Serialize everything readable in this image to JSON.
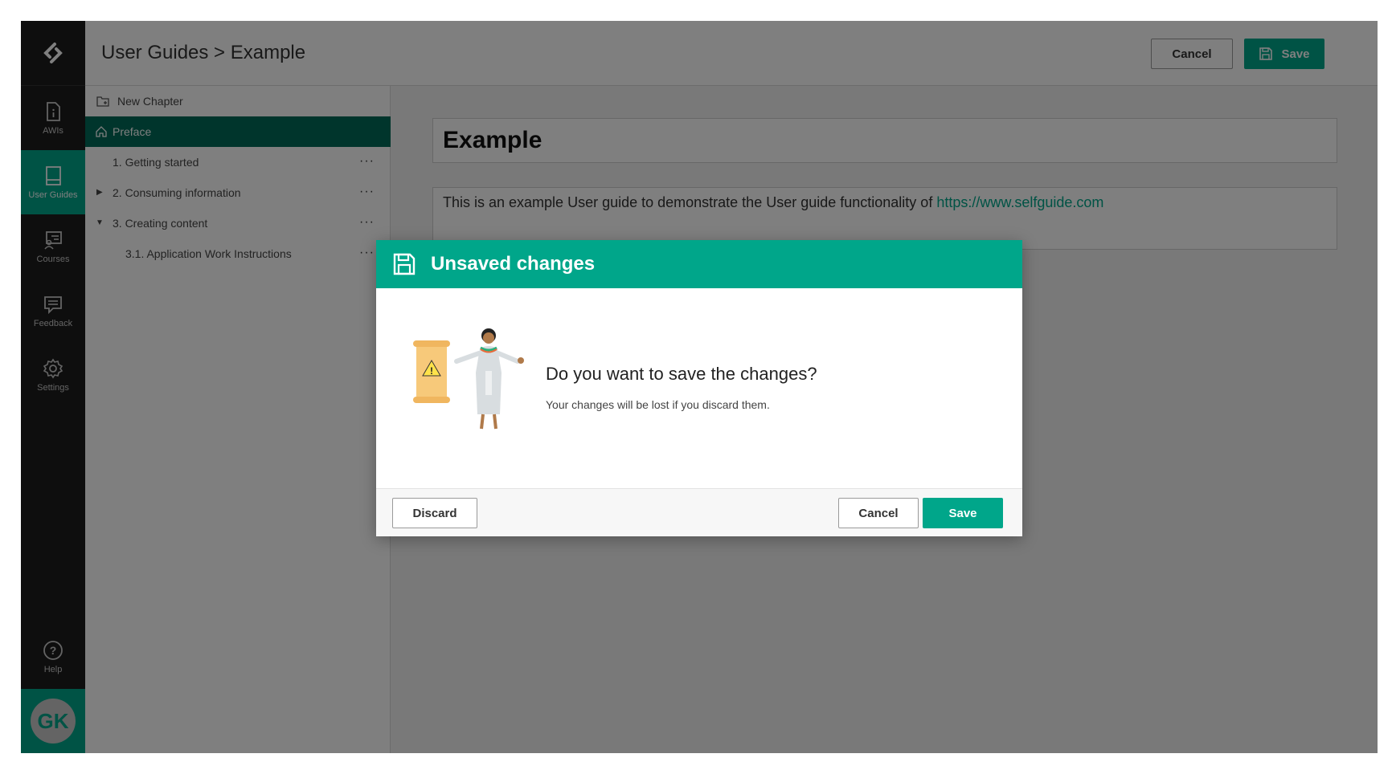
{
  "rail": {
    "items": [
      {
        "label": "AWIs",
        "icon": "document-info-icon"
      },
      {
        "label": "User Guides",
        "icon": "book-icon",
        "active": true
      },
      {
        "label": "Courses",
        "icon": "courses-icon"
      },
      {
        "label": "Feedback",
        "icon": "feedback-icon"
      },
      {
        "label": "Settings",
        "icon": "gear-icon"
      }
    ],
    "help_label": "Help",
    "avatar_initials": "GK"
  },
  "header": {
    "breadcrumb": "User Guides > Example",
    "cancel_label": "Cancel",
    "save_label": "Save"
  },
  "tree": {
    "new_chapter": "New Chapter",
    "preface": "Preface",
    "items": [
      {
        "label": "1.  Getting started",
        "more": "···"
      },
      {
        "label": "2.  Consuming information",
        "more": "···"
      },
      {
        "label": "3.  Creating content",
        "more": "···"
      },
      {
        "label": "3.1.  Application Work Instructions",
        "more": "···"
      }
    ]
  },
  "editor": {
    "title": "Example",
    "body_text": "This is an example User guide to demonstrate the User guide functionality of ",
    "body_link": "https://www.selfguide.com"
  },
  "modal": {
    "title": "Unsaved changes",
    "question": "Do you want to save the changes?",
    "subtext": "Your changes will be lost if you discard them.",
    "discard_label": "Discard",
    "cancel_label": "Cancel",
    "save_label": "Save"
  },
  "colors": {
    "accent": "#00a68a",
    "active_tree": "#006b59",
    "rail_bg": "#1d1d1d"
  }
}
